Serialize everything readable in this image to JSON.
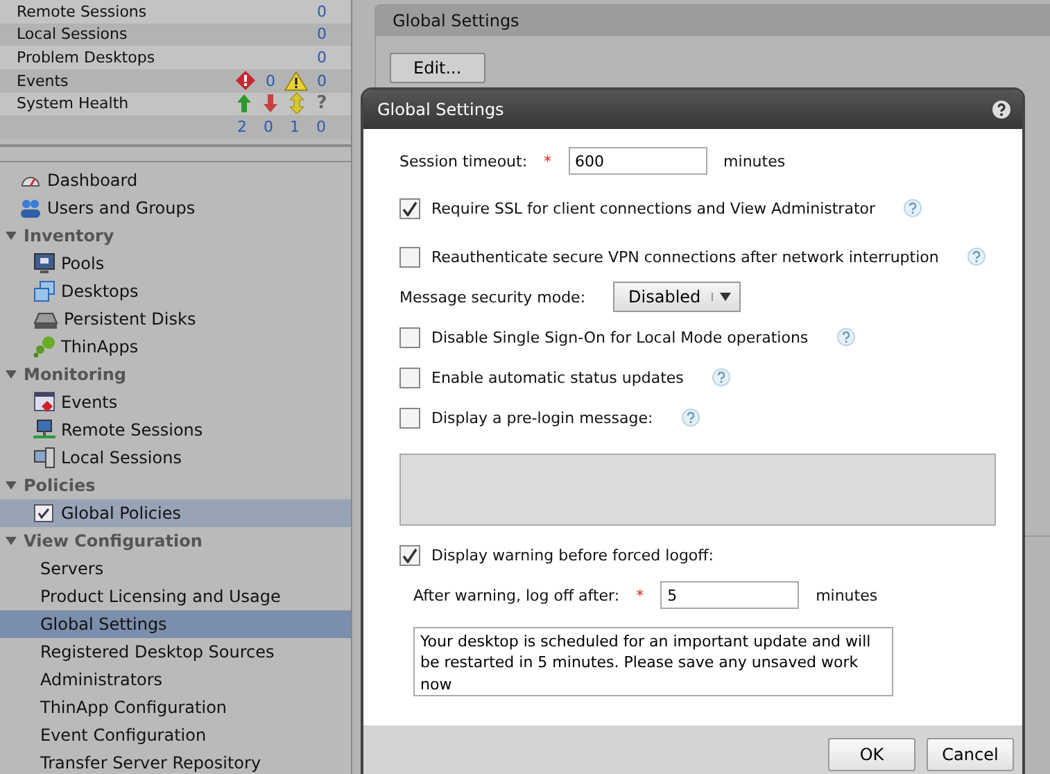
{
  "summary": {
    "rows": [
      {
        "kind": "count",
        "label": "Remote Sessions",
        "value": "0"
      },
      {
        "kind": "count",
        "label": "Local Sessions",
        "value": "0"
      },
      {
        "kind": "count",
        "label": "Problem Desktops",
        "value": "0"
      },
      {
        "kind": "alerts",
        "label": "Events",
        "errors": "0",
        "warnings": "0"
      },
      {
        "kind": "health",
        "label": "System Health",
        "glyph": "?",
        "counts": [
          "2",
          "0",
          "1",
          "0"
        ]
      }
    ]
  },
  "nav": [
    {
      "label": "Dashboard",
      "selected": false
    },
    {
      "label": "Users and Groups",
      "selected": false
    },
    {
      "label": "Inventory",
      "expanded": true,
      "children": [
        {
          "label": "Pools",
          "selected": false
        },
        {
          "label": "Desktops",
          "selected": false
        },
        {
          "label": "Persistent Disks",
          "selected": false
        },
        {
          "label": "ThinApps",
          "selected": false
        }
      ]
    },
    {
      "label": "Monitoring",
      "expanded": true,
      "children": [
        {
          "label": "Events",
          "selected": false
        },
        {
          "label": "Remote Sessions",
          "selected": false
        },
        {
          "label": "Local Sessions",
          "selected": false
        }
      ]
    },
    {
      "label": "Policies",
      "expanded": true,
      "children": [
        {
          "label": "Global Policies",
          "selected": false,
          "highlighted": true
        }
      ]
    },
    {
      "label": "View Configuration",
      "expanded": true,
      "children": [
        {
          "label": "Servers",
          "selected": false
        },
        {
          "label": "Product Licensing and Usage",
          "selected": false
        },
        {
          "label": "Global Settings",
          "selected": true
        },
        {
          "label": "Registered Desktop Sources",
          "selected": false
        },
        {
          "label": "Administrators",
          "selected": false
        },
        {
          "label": "ThinApp Configuration",
          "selected": false
        },
        {
          "label": "Event Configuration",
          "selected": false
        },
        {
          "label": "Transfer Server Repository",
          "selected": false
        }
      ]
    }
  ],
  "panel": {
    "title": "Global Settings",
    "button": "Edit..."
  },
  "dialog": {
    "title": "Global Settings",
    "fields": [
      {
        "kind": "number",
        "label": "Session timeout:",
        "required": "*",
        "value": "600",
        "unit": "minutes"
      },
      {
        "kind": "checkbox",
        "label": "Require SSL for client connections and View Administrator",
        "checked": true,
        "help": true
      },
      {
        "kind": "checkbox",
        "label": "Reauthenticate secure VPN connections after network interruption",
        "checked": false,
        "help": true
      },
      {
        "kind": "select",
        "label": "Message security mode:",
        "value": "Disabled"
      },
      {
        "kind": "checkbox",
        "label": "Disable Single Sign-On for Local Mode operations",
        "checked": false,
        "help": true
      },
      {
        "kind": "checkbox",
        "label": "Enable automatic status updates",
        "checked": false,
        "help": true
      },
      {
        "kind": "checkbox",
        "label": "Display a pre-login message:",
        "checked": false,
        "help": true
      },
      {
        "kind": "message",
        "disabled": true
      },
      {
        "kind": "checkbox",
        "label": "Display warning before forced logoff:",
        "checked": true,
        "help": false
      },
      {
        "kind": "number",
        "label": "After warning, log off after:",
        "required": "*",
        "value": "5",
        "unit": "minutes",
        "indent": true
      },
      {
        "kind": "message",
        "disabled": false,
        "value": "Your desktop is scheduled for an important update and will be restarted in 5 minutes. Please save any unsaved work now"
      }
    ],
    "buttons": [
      "OK",
      "Cancel"
    ]
  }
}
